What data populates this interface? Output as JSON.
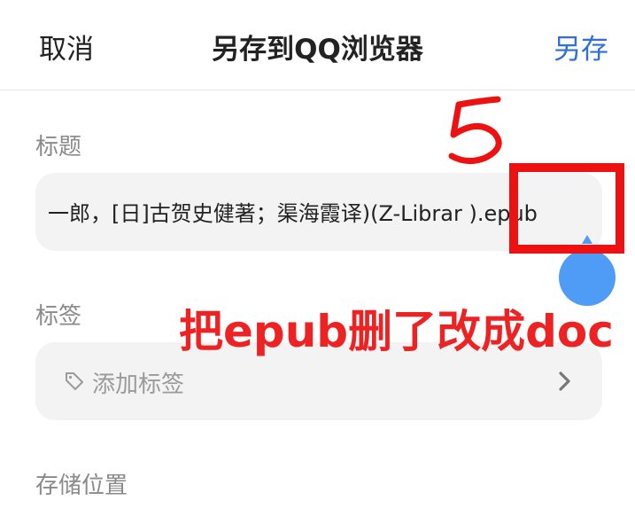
{
  "header": {
    "cancel_label": "取消",
    "title": "另存到QQ浏览器",
    "save_label": "另存"
  },
  "title_section": {
    "label": "标题",
    "value": "一郎，[日]古贺史健著；渠海霞译)(Z-Librar  ).epub"
  },
  "tags_section": {
    "label": "标签",
    "placeholder": "添加标签",
    "icon": "tag-icon"
  },
  "storage_section": {
    "label": "存储位置"
  },
  "annotations": {
    "step_number": "5",
    "instruction": "把epub删了改成doc",
    "color": "#ee1111"
  },
  "colors": {
    "accent": "#2f6fd6",
    "handle": "#4f9cf7"
  }
}
